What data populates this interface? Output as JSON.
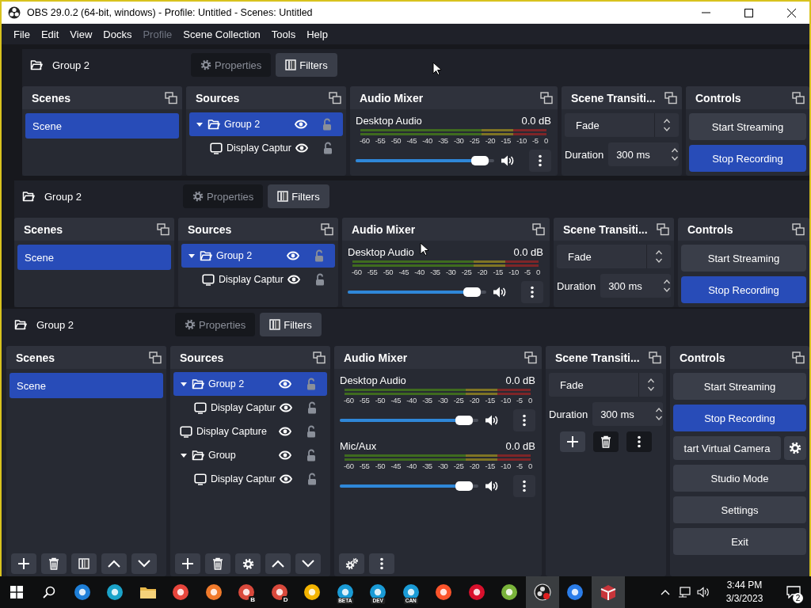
{
  "window": {
    "title": "OBS 29.0.2 (64-bit, windows) - Profile: Untitled - Scenes: Untitled"
  },
  "menu": [
    {
      "label": "File",
      "disabled": false
    },
    {
      "label": "Edit",
      "disabled": false
    },
    {
      "label": "View",
      "disabled": false
    },
    {
      "label": "Docks",
      "disabled": false
    },
    {
      "label": "Profile",
      "disabled": true
    },
    {
      "label": "Scene Collection",
      "disabled": false
    },
    {
      "label": "Tools",
      "disabled": false
    },
    {
      "label": "Help",
      "disabled": false
    }
  ],
  "preview": {
    "captures": [
      {
        "source_toolbar": {
          "source": "Group 2",
          "buttons": [
            {
              "kind": "properties",
              "label": "Properties",
              "disabled": true
            },
            {
              "kind": "filters",
              "label": "Filters",
              "disabled": false
            }
          ]
        },
        "scenes": {
          "title": "Scenes",
          "items": [
            {
              "label": "Scene",
              "selected": true
            }
          ]
        },
        "sources": {
          "title": "Sources",
          "items": [
            {
              "kind": "group",
              "label": "Group 2",
              "expanded": true,
              "selected": true,
              "visible": true,
              "locked": false,
              "children": [
                {
                  "kind": "display",
                  "label": "Display Captur",
                  "selected": false,
                  "visible": true,
                  "locked": false
                }
              ]
            }
          ]
        },
        "mixer": {
          "title": "Audio Mixer",
          "channels": [
            {
              "name": "Desktop Audio",
              "reading": "0.0 dB",
              "level": 0.95,
              "ticks": [
                "-60",
                "-55",
                "-50",
                "-45",
                "-40",
                "-35",
                "-30",
                "-25",
                "-20",
                "-15",
                "-10",
                "-5",
                "0"
              ]
            }
          ]
        },
        "transitions": {
          "title": "Scene Transiti...",
          "transition": "Fade",
          "duration_label": "Duration",
          "duration": "300 ms"
        },
        "controls": {
          "title": "Controls",
          "buttons": [
            {
              "kind": "button",
              "label": "Start Streaming",
              "active": false
            },
            {
              "kind": "button",
              "label": "Stop Recording",
              "active": true
            }
          ]
        }
      },
      {
        "source_toolbar": {
          "source": "Group 2",
          "buttons": [
            {
              "kind": "properties",
              "label": "Properties",
              "disabled": true
            },
            {
              "kind": "filters",
              "label": "Filters",
              "disabled": false
            }
          ]
        },
        "scenes": {
          "title": "Scenes",
          "items": [
            {
              "label": "Scene",
              "selected": true
            }
          ]
        },
        "sources": {
          "title": "Sources",
          "items": [
            {
              "kind": "group",
              "label": "Group 2",
              "expanded": true,
              "selected": true,
              "visible": true,
              "locked": false,
              "children": [
                {
                  "kind": "display",
                  "label": "Display Captur",
                  "selected": false,
                  "visible": true,
                  "locked": false
                }
              ]
            }
          ]
        },
        "mixer": {
          "title": "Audio Mixer",
          "channels": [
            {
              "name": "Desktop Audio",
              "reading": "0.0 dB",
              "level": 0.95,
              "ticks": [
                "-60",
                "-55",
                "-50",
                "-45",
                "-40",
                "-35",
                "-30",
                "-25",
                "-20",
                "-15",
                "-10",
                "-5",
                "0"
              ]
            }
          ]
        },
        "transitions": {
          "title": "Scene Transiti...",
          "transition": "Fade",
          "duration_label": "Duration",
          "duration": "300 ms"
        },
        "controls": {
          "title": "Controls",
          "buttons": [
            {
              "kind": "button",
              "label": "Start Streaming",
              "active": false
            },
            {
              "kind": "button",
              "label": "Stop Recording",
              "active": true
            }
          ]
        }
      }
    ]
  },
  "main": {
    "source_toolbar": {
      "source": "Group 2",
      "buttons": [
        {
          "kind": "properties",
          "label": "Properties",
          "disabled": true
        },
        {
          "kind": "filters",
          "label": "Filters",
          "disabled": false
        }
      ]
    },
    "scenes": {
      "title": "Scenes",
      "items": [
        {
          "label": "Scene",
          "selected": true
        }
      ],
      "toolbar": [
        {
          "kind": "add"
        },
        {
          "kind": "remove"
        },
        {
          "kind": "filters"
        },
        {
          "kind": "up"
        },
        {
          "kind": "down"
        }
      ]
    },
    "sources": {
      "title": "Sources",
      "items": [
        {
          "kind": "group",
          "label": "Group 2",
          "expanded": true,
          "selected": true,
          "visible": true,
          "locked": false,
          "children": [
            {
              "kind": "display",
              "label": "Display Captur",
              "selected": false,
              "visible": true,
              "locked": false
            }
          ]
        },
        {
          "kind": "display",
          "label": "Display Capture",
          "selected": false,
          "visible": true,
          "locked": false
        },
        {
          "kind": "group",
          "label": "Group",
          "expanded": true,
          "selected": false,
          "visible": true,
          "locked": false,
          "children": [
            {
              "kind": "display",
              "label": "Display Captur",
              "selected": false,
              "visible": true,
              "locked": false
            }
          ]
        }
      ],
      "toolbar": [
        {
          "kind": "add"
        },
        {
          "kind": "remove"
        },
        {
          "kind": "properties"
        },
        {
          "kind": "up"
        },
        {
          "kind": "down"
        }
      ]
    },
    "mixer": {
      "title": "Audio Mixer",
      "channels": [
        {
          "name": "Desktop Audio",
          "reading": "0.0 dB",
          "level": 0.95,
          "ticks": [
            "-60",
            "-55",
            "-50",
            "-45",
            "-40",
            "-35",
            "-30",
            "-25",
            "-20",
            "-15",
            "-10",
            "-5",
            "0"
          ]
        },
        {
          "name": "Mic/Aux",
          "reading": "0.0 dB",
          "level": 0.95,
          "ticks": [
            "-60",
            "-55",
            "-50",
            "-45",
            "-40",
            "-35",
            "-30",
            "-25",
            "-20",
            "-15",
            "-10",
            "-5",
            "0"
          ]
        }
      ],
      "toolbar": [
        {
          "kind": "advanced"
        },
        {
          "kind": "menu"
        }
      ]
    },
    "transitions": {
      "title": "Scene Transiti...",
      "transition": "Fade",
      "duration_label": "Duration",
      "duration": "300 ms",
      "toolbar": [
        {
          "kind": "add",
          "disabled": false
        },
        {
          "kind": "remove",
          "disabled": true
        },
        {
          "kind": "menu",
          "disabled": true
        }
      ]
    },
    "controls": {
      "title": "Controls",
      "buttons": [
        {
          "kind": "button",
          "label": "Start Streaming",
          "active": false
        },
        {
          "kind": "button",
          "label": "Stop Recording",
          "active": true
        },
        {
          "kind": "camera",
          "label": "tart Virtual Camera",
          "active": false
        },
        {
          "kind": "button",
          "label": "Studio Mode",
          "active": false
        },
        {
          "kind": "button",
          "label": "Settings",
          "active": false
        },
        {
          "kind": "button",
          "label": "Exit",
          "active": false
        }
      ]
    }
  },
  "taskbar": {
    "items": [
      {
        "kind": "start",
        "active": false
      },
      {
        "kind": "search",
        "active": false
      },
      {
        "kind": "browser",
        "color": "#1e7fd8",
        "active": false
      },
      {
        "kind": "browser",
        "color": "#1ba3c9",
        "active": false
      },
      {
        "kind": "folder",
        "color": "#e8b84a",
        "active": false
      },
      {
        "kind": "browser",
        "color": "#e8453c",
        "active": false
      },
      {
        "kind": "browser",
        "color": "#f07a2b",
        "active": false
      },
      {
        "kind": "browser",
        "color": "#d9493c",
        "badge": "B",
        "active": false
      },
      {
        "kind": "browser",
        "color": "#d9493c",
        "badge": "D",
        "active": false
      },
      {
        "kind": "browser",
        "color": "#f4b400",
        "active": false
      },
      {
        "kind": "browser",
        "color": "#1a9bd6",
        "badge": "BETA",
        "active": false
      },
      {
        "kind": "browser",
        "color": "#1a9bd6",
        "badge": "DEV",
        "active": false
      },
      {
        "kind": "browser",
        "color": "#1a9bd6",
        "badge": "CAN",
        "active": false
      },
      {
        "kind": "browser",
        "color": "#fb542b",
        "active": false
      },
      {
        "kind": "browser",
        "color": "#d8102c",
        "active": false
      },
      {
        "kind": "browser",
        "color": "#79b33a",
        "active": false
      },
      {
        "kind": "obs",
        "color": "#1c1c1c",
        "active": true
      },
      {
        "kind": "browser",
        "color": "#2b7de9",
        "active": false
      },
      {
        "kind": "app",
        "color": "#c8353a",
        "active": true
      }
    ],
    "tray": {
      "time": "3:44 PM",
      "date": "3/3/2023",
      "notifications": "2"
    }
  }
}
